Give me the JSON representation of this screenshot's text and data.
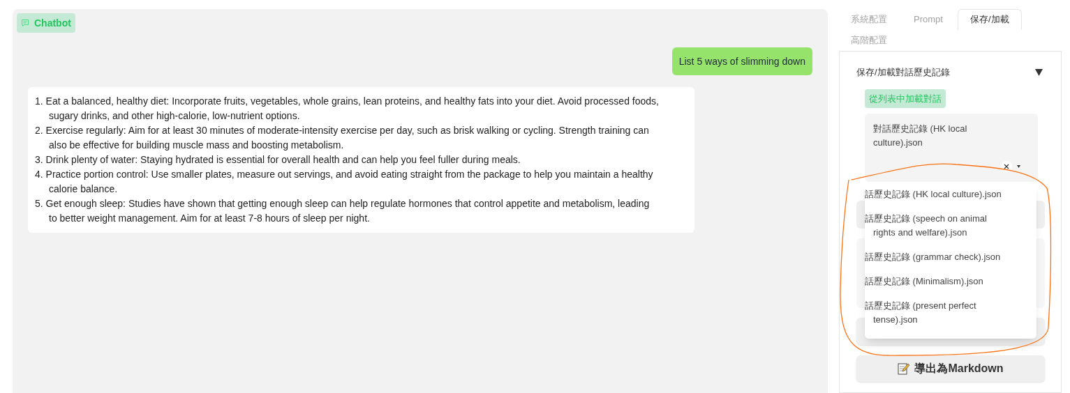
{
  "chatbot": {
    "label": "Chatbot",
    "messages": [
      {
        "kind": "user",
        "text": "List 5 ways of slimming down"
      },
      {
        "kind": "bot",
        "items": [
          "1. Eat a balanced, healthy diet: Incorporate fruits, vegetables, whole grains, lean proteins, and healthy fats into your diet. Avoid processed foods, sugary drinks, and other high-calorie, low-nutrient options.",
          "2. Exercise regularly: Aim for at least 30 minutes of moderate-intensity exercise per day, such as brisk walking or cycling. Strength training can also be effective for building muscle mass and boosting metabolism.",
          "3. Drink plenty of water: Staying hydrated is essential for overall health and can help you feel fuller during meals.",
          "4. Practice portion control: Use smaller plates, measure out servings, and avoid eating straight from the package to help you maintain a healthy calorie balance.",
          "5. Get enough sleep: Studies have shown that getting enough sleep can help regulate hormones that control appetite and metabolism, leading to better weight management. Aim for at least 7-8 hours of sleep per night."
        ]
      }
    ]
  },
  "tabs": [
    {
      "label": "系統配置",
      "selected": false
    },
    {
      "label": "Prompt",
      "selected": false
    },
    {
      "label": "保存/加載",
      "selected": true
    },
    {
      "label": "高階配置",
      "selected": false
    }
  ],
  "accordion": {
    "title": "保存/加載對話歷史記錄",
    "expanded": true,
    "dropdown": {
      "label": "從列表中加載對話",
      "value": "對話歷史記錄 (HK local culture).json",
      "options": [
        "話歷史記錄 (HK local culture).json",
        "話歷史記錄 (speech on animal rights and welfare).json",
        "話歷史記錄 (grammar check).json",
        "話歷史記錄 (Minimalism).json",
        "話歷史記錄 (present perfect tense).json"
      ]
    },
    "export_button": "導出為Markdown"
  }
}
